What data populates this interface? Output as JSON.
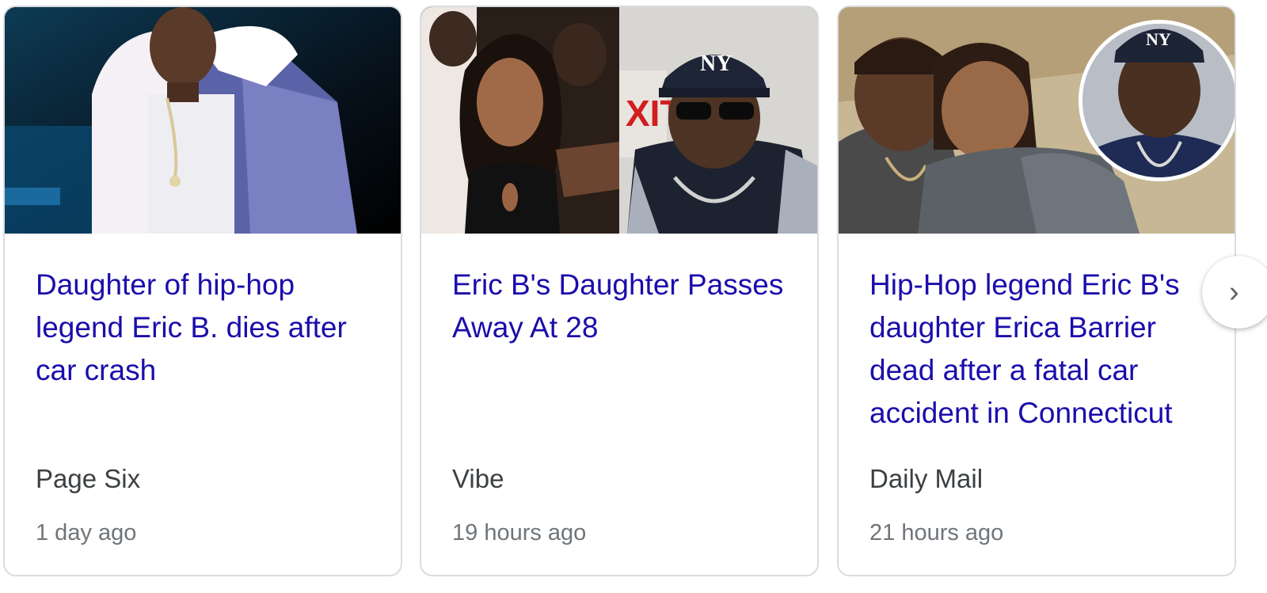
{
  "cards": [
    {
      "headline": "Daughter of hip-hop legend Eric B. dies after car crash",
      "source": "Page Six",
      "time": "1 day ago",
      "image_icon": "performer-photo"
    },
    {
      "headline": "Eric B's Daughter Passes Away At 28",
      "source": "Vibe",
      "time": "19 hours ago",
      "image_icon": "split-portrait-photo"
    },
    {
      "headline": "Hip-Hop legend Eric B's daughter Erica Barrier dead after a fatal car accident in Connecticut",
      "source": "Daily Mail",
      "time": "21 hours ago",
      "image_icon": "couple-photo-with-inset"
    }
  ],
  "navigation": {
    "next_icon": "chevron-right-icon",
    "next_glyph": "›"
  },
  "colors": {
    "headline": "#1a0dab",
    "source": "#3c4043",
    "time": "#70757a",
    "border": "#dadce0"
  }
}
